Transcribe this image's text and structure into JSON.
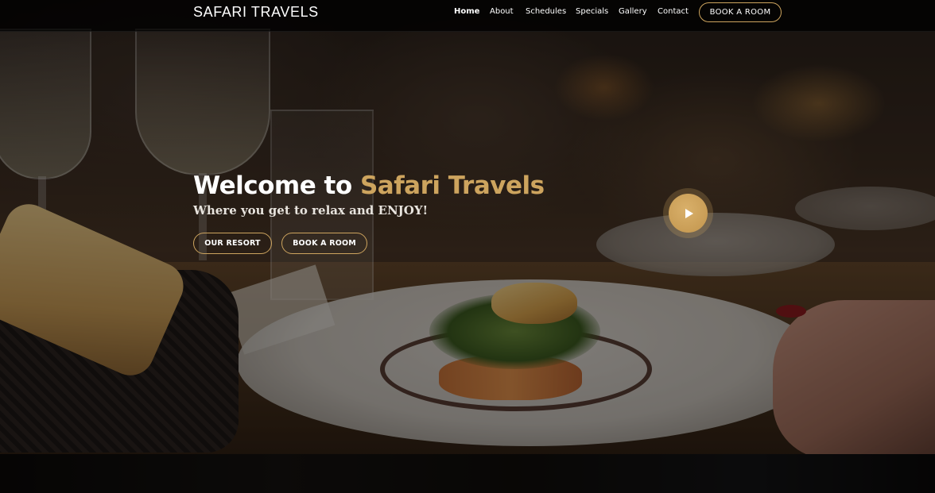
{
  "header": {
    "logo": "SAFARI TRAVELS",
    "nav": [
      {
        "label": "Home",
        "active": true
      },
      {
        "label": "About",
        "active": false
      },
      {
        "label": "Schedules",
        "active": false
      },
      {
        "label": "Specials",
        "active": false
      },
      {
        "label": "Gallery",
        "active": false
      },
      {
        "label": "Contact",
        "active": false
      }
    ],
    "book_button": "BOOK A ROOM"
  },
  "hero": {
    "welcome_prefix": "Welcome to ",
    "welcome_brand": "Safari Travels",
    "tagline": "Where you get to relax and ENJOY!",
    "buttons": {
      "resort": "OUR RESORT",
      "book": "BOOK A ROOM"
    },
    "play_icon": "play-icon"
  },
  "colors": {
    "accent": "#cda45e",
    "header_bg": "#000000",
    "text": "#ffffff"
  }
}
